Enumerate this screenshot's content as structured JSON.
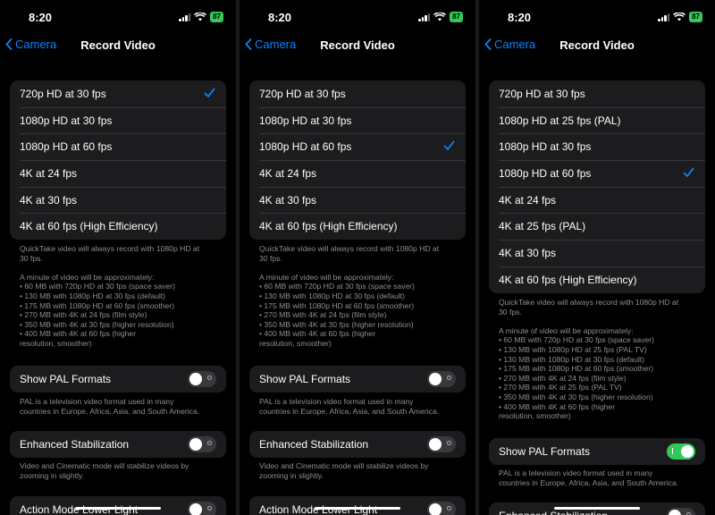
{
  "status": {
    "time": "8:20",
    "battery": "87"
  },
  "nav": {
    "back_label": "Camera",
    "title": "Record Video"
  },
  "panels": [
    {
      "options": [
        "720p HD at 30 fps",
        "1080p HD at 30 fps",
        "1080p HD at 60 fps",
        "4K at 24 fps",
        "4K at 30 fps",
        "4K at 60 fps (High Efficiency)"
      ],
      "selected_index": 0,
      "footer_quicktake": [
        "QuickTake video will always record with 1080p HD at",
        "30 fps."
      ],
      "footer_minute": [
        "A minute of video will be approximately:",
        "• 60 MB with 720p HD at 30 fps (space saver)",
        "• 130 MB with 1080p HD at 30 fps (default)",
        "• 175 MB with 1080p HD at 60 fps (smoother)",
        "• 270 MB with 4K at 24 fps (film style)",
        "• 350 MB with 4K at 30 fps (higher resolution)",
        "• 400 MB with 4K at 60 fps (higher",
        "resolution, smoother)"
      ],
      "pal": {
        "label": "Show PAL Formats",
        "on": false,
        "desc": [
          "PAL is a television video format used in many",
          "countries in Europe, Africa, Asia, and South America."
        ]
      },
      "stab": {
        "label": "Enhanced Stabilization",
        "on": false,
        "desc": [
          "Video and Cinematic mode will stabilize videos by",
          "zooming in slightly."
        ]
      },
      "action": {
        "label": "Action Mode Lower Light",
        "on": false
      }
    },
    {
      "options": [
        "720p HD at 30 fps",
        "1080p HD at 30 fps",
        "1080p HD at 60 fps",
        "4K at 24 fps",
        "4K at 30 fps",
        "4K at 60 fps (High Efficiency)"
      ],
      "selected_index": 2,
      "footer_quicktake": [
        "QuickTake video will always record with 1080p HD at",
        "30 fps."
      ],
      "footer_minute": [
        "A minute of video will be approximately:",
        "• 60 MB with 720p HD at 30 fps (space saver)",
        "• 130 MB with 1080p HD at 30 fps (default)",
        "• 175 MB with 1080p HD at 60 fps (smoother)",
        "• 270 MB with 4K at 24 fps (film style)",
        "• 350 MB with 4K at 30 fps (higher resolution)",
        "• 400 MB with 4K at 60 fps (higher",
        "resolution, smoother)"
      ],
      "pal": {
        "label": "Show PAL Formats",
        "on": false,
        "desc": [
          "PAL is a television video format used in many",
          "countries in Europe, Africa, Asia, and South America."
        ]
      },
      "stab": {
        "label": "Enhanced Stabilization",
        "on": false,
        "desc": [
          "Video and Cinematic mode will stabilize videos by",
          "zooming in slightly."
        ]
      },
      "action": {
        "label": "Action Mode Lower Light",
        "on": false
      }
    },
    {
      "options": [
        "720p HD at 30 fps",
        "1080p HD at 25 fps (PAL)",
        "1080p HD at 30 fps",
        "1080p HD at 60 fps",
        "4K at 24 fps",
        "4K at 25 fps (PAL)",
        "4K at 30 fps",
        "4K at 60 fps (High Efficiency)"
      ],
      "selected_index": 3,
      "footer_quicktake": [
        "QuickTake video will always record with 1080p HD at",
        "30 fps."
      ],
      "footer_minute": [
        "A minute of video will be approximately:",
        "• 60 MB with 720p HD at 30 fps (space saver)",
        "• 130 MB with 1080p HD at 25 fps (PAL TV)",
        "• 130 MB with 1080p HD at 30 fps (default)",
        "• 175 MB with 1080p HD at 60 fps (smoother)",
        "• 270 MB with 4K at 24 fps (film style)",
        "• 270 MB with 4K at 25 fps (PAL TV)",
        "• 350 MB with 4K at 30 fps (higher resolution)",
        "• 400 MB with 4K at 60 fps (higher",
        "resolution, smoother)"
      ],
      "pal": {
        "label": "Show PAL Formats",
        "on": true,
        "desc": [
          "PAL is a television video format used in many",
          "countries in Europe, Africa, Asia, and South America."
        ]
      },
      "stab": {
        "label": "Enhanced Stabilization",
        "on": false,
        "desc": []
      },
      "action": null
    }
  ],
  "colors": {
    "accent": "#0a84ff",
    "toggle_on": "#34c759",
    "row_bg": "#1c1c1e",
    "footer_text": "#8e8e93"
  }
}
